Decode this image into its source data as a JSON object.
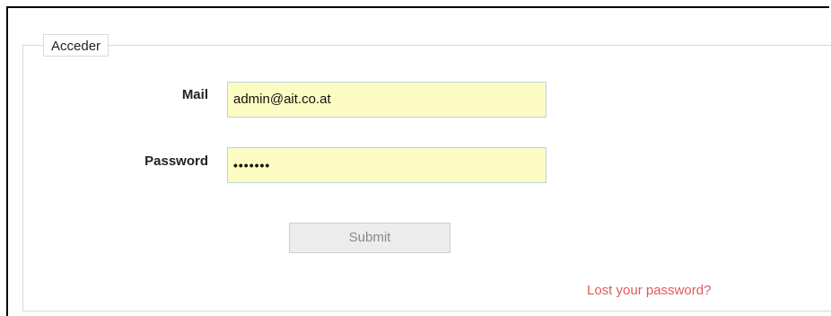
{
  "form": {
    "legend": "Acceder",
    "fields": {
      "mail": {
        "label": "Mail",
        "value": "admin@ait.co.at"
      },
      "password": {
        "label": "Password",
        "masked_value": "•••••••"
      }
    },
    "submit_label": "Submit",
    "lost_password_link": "Lost your password?"
  },
  "colors": {
    "input_background": "#fcfcc2",
    "link": "#e05a5a",
    "submit_background": "#ececec",
    "submit_text": "#8a8a8a"
  }
}
